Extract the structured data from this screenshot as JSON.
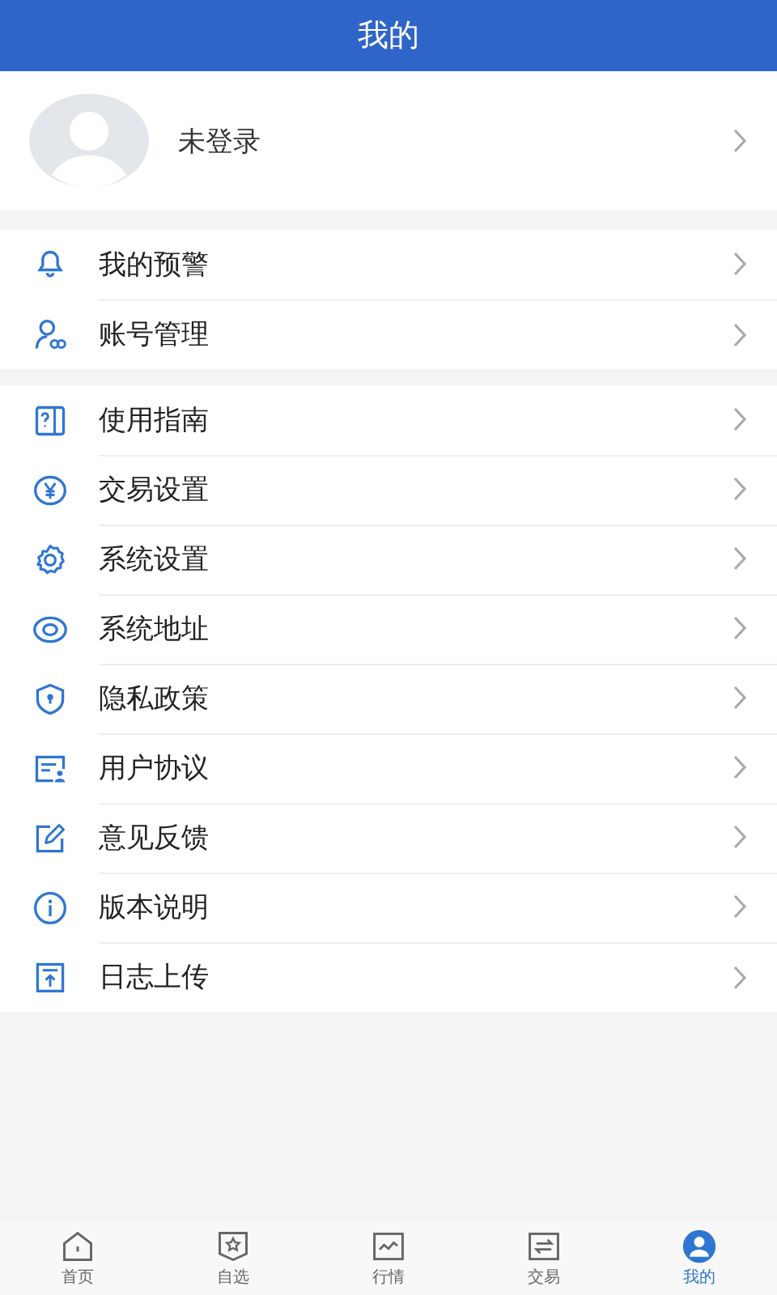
{
  "header": {
    "title": "我的"
  },
  "profile": {
    "name": "未登录"
  },
  "sections": [
    {
      "items": [
        {
          "label": "我的预警"
        },
        {
          "label": "账号管理"
        }
      ]
    },
    {
      "items": [
        {
          "label": "使用指南"
        },
        {
          "label": "交易设置"
        },
        {
          "label": "系统设置"
        },
        {
          "label": "系统地址"
        },
        {
          "label": "隐私政策"
        },
        {
          "label": "用户协议"
        },
        {
          "label": "意见反馈"
        },
        {
          "label": "版本说明"
        },
        {
          "label": "日志上传"
        }
      ]
    }
  ],
  "tabs": [
    {
      "label": "首页",
      "selected": false
    },
    {
      "label": "自选",
      "selected": false
    },
    {
      "label": "行情",
      "selected": false
    },
    {
      "label": "交易",
      "selected": false
    },
    {
      "label": "我的",
      "selected": true
    }
  ]
}
